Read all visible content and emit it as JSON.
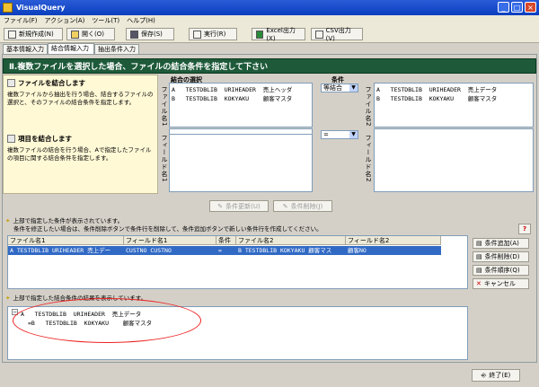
{
  "window": {
    "title": "VisualQuery",
    "min": "_",
    "max": "□",
    "close": "×"
  },
  "menu": [
    "ファイル(F)",
    "アクション(A)",
    "ツール(T)",
    "ヘルプ(H)"
  ],
  "toolbar": {
    "new": "新規作成(N)",
    "open": "開く(O)",
    "save": "保存(S)",
    "run": "実行(R)",
    "excel": "Excel出力(X)",
    "csv": "CSV出力(V)"
  },
  "tabs": [
    "基本情報入力",
    "結合情報入力",
    "抽出条件入力"
  ],
  "header": "Ⅱ.複数ファイルを選択した場合、ファイルの結合条件を指定して下さい",
  "left": {
    "file_title": "ファイルを結合します",
    "file_desc": "複数ファイルから抽出を行う場合、結合するファイルの選択と、そのファイルの結合条件を指定します。",
    "item_title": "項目を結合します",
    "item_desc": "複数ファイルの結合を行う場合、Aで指定したファイルの項目に関する結合条件を指定します。"
  },
  "join": {
    "select_label": "結合の選択",
    "condition_label": "条件",
    "file1_label": "ファイル名1",
    "file2_label": "ファイル名2",
    "field1_label": "フィールド名1",
    "field2_label": "フィールド名2",
    "file1_items": [
      "A   TESTDBLIB  URIHEADER  売上ヘッダ",
      "B   TESTDBLIB  KOKYAKU    顧客マスタ"
    ],
    "file2_items": [
      "A   TESTDBLIB  URIHEADER  売上データ",
      "B   TESTDBLIB  KOKYAKU    顧客マスタ"
    ],
    "join_type": "等結合",
    "operator": "="
  },
  "actions": {
    "update": "条件更新(U)",
    "delete_disabled": "条件削除(J)"
  },
  "info1": {
    "line1": "上部で指定した条件が表示されています。",
    "line2": "条件を修正したい場合は、条件削除ボタンで条件行を削除して、条件追加ボタンで新しい条件行を作成してください。"
  },
  "help": "?",
  "grid": {
    "columns": [
      "ファイル名1",
      "フィールド名1",
      "条件",
      "ファイル名2",
      "フィールド名2"
    ],
    "rows": [
      [
        "A   TESTDBLIB  URIHEADER  売上デー",
        "CUSTNO      CUSTNO",
        "=",
        "B   TESTDBLIB  KOKYAKU  顧客マス",
        "顧客NO"
      ]
    ]
  },
  "side": {
    "add": "条件追加(A)",
    "remove": "条件削除(D)",
    "order": "条件順序(Q)",
    "cancel": "キャンセル"
  },
  "info2": "上部で指定した結合条件の結果を表示しています。",
  "tree": {
    "line1": "A   TESTDBLIB  URIHEADER  売上データ",
    "line2": "=B   TESTDBLIB  KOKYAKU    顧客マスタ",
    "expander": "−"
  },
  "exit": "終了(E)"
}
